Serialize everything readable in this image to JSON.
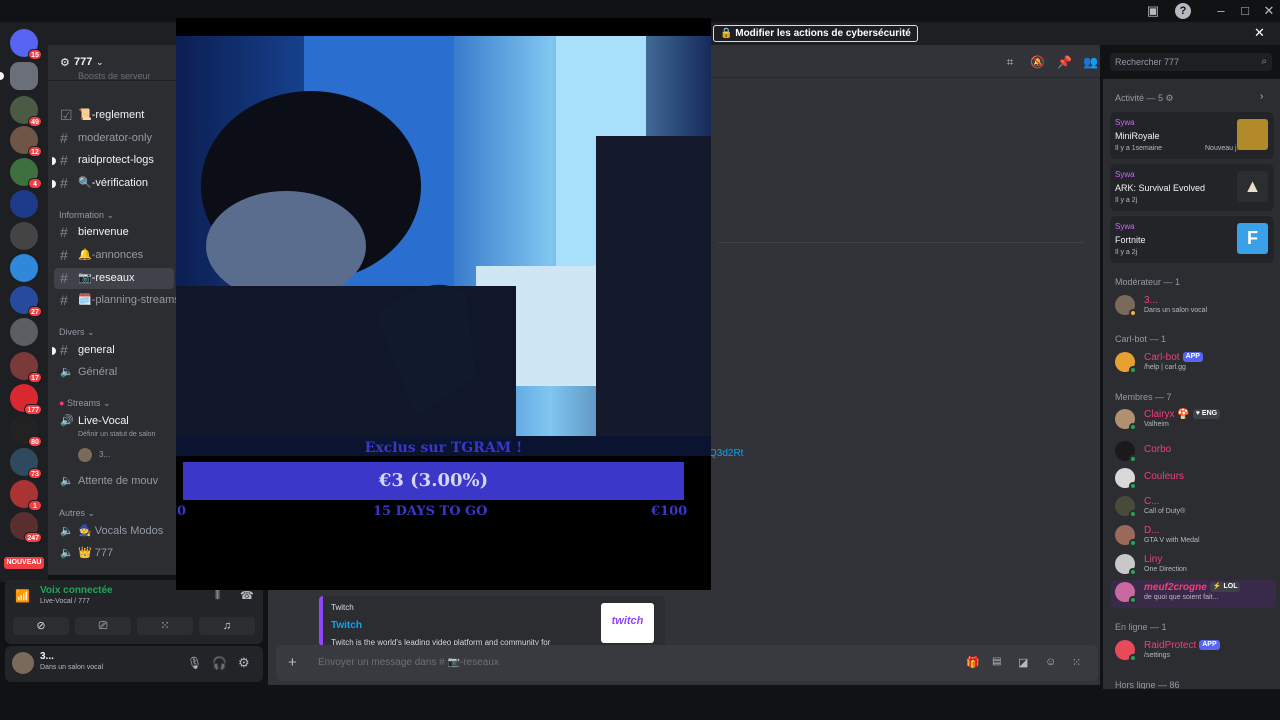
{
  "banner": {
    "security_label": "Modifier les actions de cybersécurité"
  },
  "guilds": [
    {
      "badge": "15"
    },
    {
      "badge": ""
    },
    {
      "badge": "49"
    },
    {
      "badge": "12"
    },
    {
      "badge": "4"
    },
    {
      "badge": ""
    },
    {
      "badge": ""
    },
    {
      "badge": ""
    },
    {
      "badge": "27"
    },
    {
      "badge": ""
    },
    {
      "badge": "17"
    },
    {
      "badge": "177"
    },
    {
      "badge": "80"
    },
    {
      "badge": "73"
    },
    {
      "badge": "1"
    },
    {
      "badge": "247"
    }
  ],
  "nouveau_label": "NOUVEAU",
  "server": {
    "name": "777",
    "boost_label": "Boosts de serveur",
    "categories": {
      "information": "Information",
      "divers": "Divers",
      "streams": "Streams",
      "autres": "Autres"
    },
    "channels": {
      "reglement": "📜-reglement",
      "moderator_only": "moderator-only",
      "raidprotect_logs": "raidprotect-logs",
      "verification": "🔍-vérification",
      "bienvenue": "bienvenue",
      "annonces": "🔔-annonces",
      "reseaux": "📷-reseaux",
      "planning": "🗓️-planning-streams",
      "general": "general",
      "general_voice": "Général",
      "live_vocal": "Live-Vocal",
      "live_vocal_sub": "Définir un statut de salon",
      "live_vocal_user": "3...",
      "attente": "Attente de mouv",
      "vocals_modos": "🧙 Vocals Modos",
      "seven": "👑 777"
    }
  },
  "voice": {
    "status": "Voix connectée",
    "location": "Live-Vocal / 777"
  },
  "user": {
    "name": "3...",
    "status": "Dans un salon vocal"
  },
  "stream": {
    "goal_title": "Exclus sur TGRAM !",
    "goal_amount": "€3 (3.00%)",
    "goal_progress": 0.03,
    "goal_min": "€0",
    "goal_days": "15 DAYS TO GO",
    "goal_max": "€100"
  },
  "chat": {
    "link_fragment": "Q3d2Rt",
    "embed_provider": "Twitch",
    "embed_title": "Twitch",
    "embed_desc": "Twitch is the world's leading video platform and community for",
    "embed_thumb": "twitch",
    "composer_placeholder": "Envoyer un message dans # 📷-reseaux"
  },
  "search": {
    "placeholder": "Rechercher 777"
  },
  "members": {
    "activity_header": "Activité — 5",
    "activities": [
      {
        "user": "Sywa",
        "game": "MiniRoyale",
        "time": "Il y a 1semaine",
        "extra": "Nouveau j..."
      },
      {
        "user": "Sywa",
        "game": "ARK: Survival Evolved",
        "time": "Il y a 2j",
        "extra": ""
      },
      {
        "user": "Sywa",
        "game": "Fortnite",
        "time": "Il y a 2j",
        "extra": ""
      }
    ],
    "moderator_header": "Modérateur — 1",
    "moderator": {
      "name": "3...",
      "sub": "Dans un salon vocal"
    },
    "carlbot_header": "Carl-bot — 1",
    "carlbot": {
      "name": "Carl-bot",
      "tag": "APP",
      "sub": "/help | carl.gg"
    },
    "members_header": "Membres — 7",
    "list": [
      {
        "name": "Clairyx",
        "sub": "Valheim",
        "tag": "ENG",
        "color": "#f23f78"
      },
      {
        "name": "Corbo",
        "sub": "",
        "tag": "",
        "color": "#f23f78"
      },
      {
        "name": "Couleurs",
        "sub": "",
        "tag": "",
        "color": "#f23f78"
      },
      {
        "name": "C...",
        "sub": "Call of Duty®",
        "tag": "",
        "color": "#f23f78"
      },
      {
        "name": "D...",
        "sub": "GTA V with Medal",
        "tag": "",
        "color": "#f23f78"
      },
      {
        "name": "Liny",
        "sub": "One Direction",
        "tag": "",
        "color": "#f23f78"
      },
      {
        "name": "meuf2crogne",
        "sub": "de quoi que soient fait...",
        "tag": "LOL",
        "color": "#f23f78"
      }
    ],
    "online_header": "En ligne — 1",
    "raidprotect": {
      "name": "RaidProtect",
      "tag": "APP",
      "sub": "/settings"
    },
    "offline_header": "Hors ligne — 86"
  },
  "colors": {
    "accent": "#5865f2",
    "goal": "#3a37c9",
    "online": "#23a55a",
    "role": "#f23f78",
    "sywa": "#c56cf0"
  }
}
